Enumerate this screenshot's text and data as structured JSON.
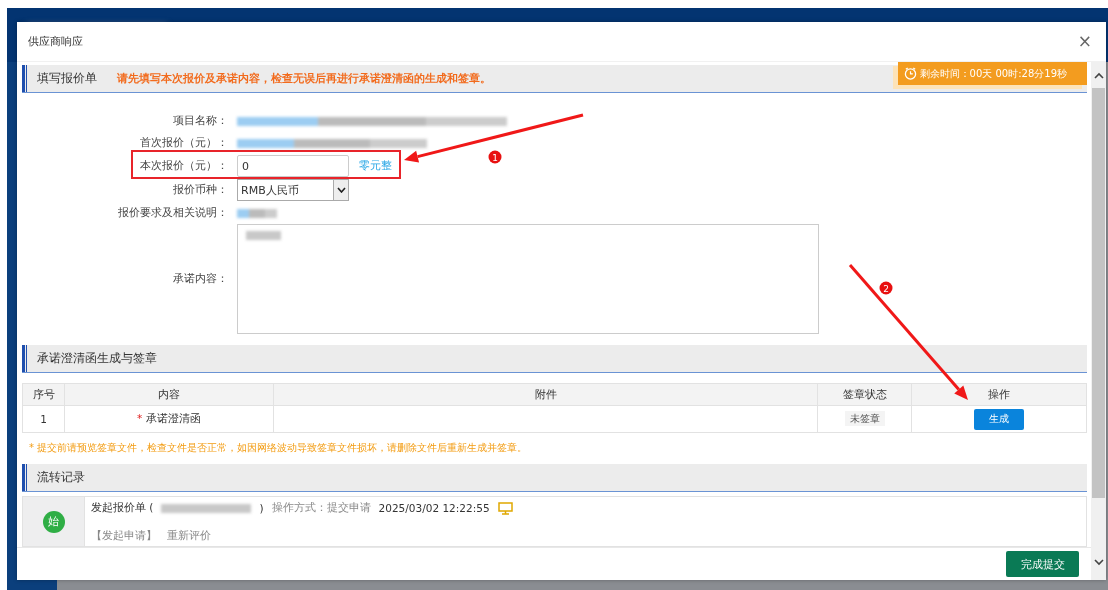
{
  "window": {
    "title": "供应商响应",
    "close": "×"
  },
  "timer": {
    "label": "剩余时间：00天 00时:28分19秒"
  },
  "quote_form": {
    "title": "填写报价单",
    "notice": "请先填写本次报价及承诺内容，检查无误后再进行承诺澄清函的生成和签章。",
    "fields": [
      {
        "kind": "blurred",
        "label": "项目名称："
      },
      {
        "kind": "blurred",
        "label": "首次报价（元）："
      },
      {
        "kind": "input",
        "label": "本次报价（元）：",
        "value": "0",
        "amount_in_words": "零元整"
      },
      {
        "kind": "select",
        "label": "报价币种：",
        "value": "RMB人民币"
      },
      {
        "kind": "blurred",
        "label": "报价要求及相关说明："
      },
      {
        "kind": "textarea",
        "label": "承诺内容："
      }
    ]
  },
  "commitment": {
    "title": "承诺澄清函生成与签章",
    "columns": [
      "序号",
      "内容",
      "附件",
      "签章状态",
      "操作"
    ],
    "rows": [
      {
        "index": "1",
        "marker": "*",
        "content": "承诺澄清函",
        "status": "未签章",
        "action": "生成"
      }
    ],
    "note": "* 提交前请预览签章文件，检查文件是否正常，如因网络波动导致签章文件损坏，请删除文件后重新生成并签章。"
  },
  "flow_log": {
    "title": "流转记录",
    "entries": [
      {
        "badge": "始",
        "action": "发起报价单 (",
        "action_end": ")",
        "method": "操作方式：提交申请",
        "time": "2025/03/02 12:22:55",
        "step": "【发起申请】",
        "comment": "重新评价"
      }
    ]
  },
  "footer": {
    "submit": "完成提交"
  },
  "annotations": [
    {
      "label": "1"
    },
    {
      "label": "2"
    }
  ]
}
